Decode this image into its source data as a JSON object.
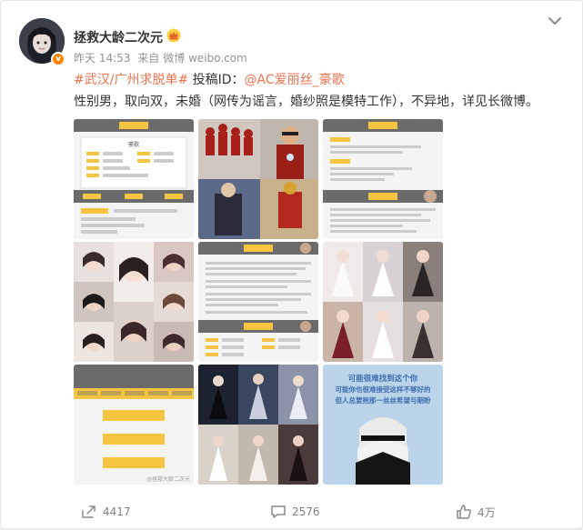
{
  "post": {
    "username": "拯救大龄二次元",
    "time": "昨天 14:53",
    "source_prefix": "来自",
    "source": "微博 weibo.com",
    "topic": "#武汉/广州求脱单#",
    "submit_label": " 投稿ID：",
    "mention": "@AC爱丽丝_豪歌",
    "body": "性别男，取向双，未婚（网传为谣言，婚纱照是模特工作），不异地，详见长微博。"
  },
  "images": [
    {
      "name": "profile-sheet-image-1"
    },
    {
      "name": "ironman-cosplay-image"
    },
    {
      "name": "profile-sheet-image-3"
    },
    {
      "name": "girl-collage-image"
    },
    {
      "name": "profile-sheet-image-5"
    },
    {
      "name": "lolita-collage-image"
    },
    {
      "name": "profile-sheet-image-7"
    },
    {
      "name": "cosplay-collage-image"
    },
    {
      "name": "nier-meme-image"
    }
  ],
  "meme_text": [
    "可能很难找到这个你",
    "可能你也很难接受这样不够好的",
    "但人总要抱那一丝丝希望与期盼"
  ],
  "watermark": "@拯救大龄二次元",
  "sheet_labels": {
    "name": "豪歌",
    "section_a": "自我介绍",
    "section_b": "择偶要求",
    "section_c": "生活照片",
    "tab1": "基本信息",
    "tab2": "兴趣爱好",
    "tab3": "工作背景",
    "tab4": "个人介绍",
    "tab5": "择偶标准",
    "rowA": "身　高",
    "rowB": "体　重",
    "rowC": "所在地",
    "rowD": "职　业"
  },
  "footer": {
    "share_count": "4417",
    "comment_count": "2576",
    "like_count": "4万"
  },
  "colors": {
    "accent": "#eb7350",
    "yellow": "#f5c542",
    "sheet_dark": "#6b6b6b"
  }
}
